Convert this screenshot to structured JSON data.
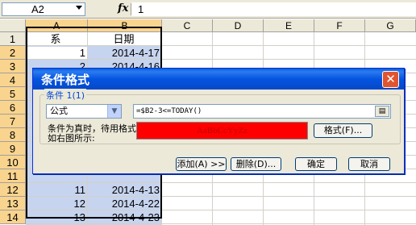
{
  "formula_bar": {
    "name_box": "A2",
    "fx_icon": "fx",
    "formula": "1"
  },
  "columns": [
    "A",
    "B",
    "C",
    "D",
    "E",
    "F",
    "G"
  ],
  "rows": [
    "1",
    "2",
    "3",
    "4",
    "5",
    "6",
    "7",
    "8",
    "9",
    "10",
    "11",
    "12",
    "13",
    "14"
  ],
  "cells": {
    "A1": "系",
    "B1": "日期",
    "A2": "1",
    "B2": "2014-4-17",
    "A3": "2",
    "B3": "2014-4-16",
    "A12": "11",
    "B12": "2014-4-13",
    "A13": "12",
    "B13": "2014-4-22",
    "A14": "13",
    "B14": "2014-4-23"
  },
  "dialog": {
    "title": "条件格式",
    "close_icon": "close-icon",
    "condition_group_label": "条件 1(1)",
    "type_select_value": "公式",
    "formula_value": "=$B2-3<=TODAY()",
    "preview_label": "条件为真时，待用格式如右图所示:",
    "preview_text": "AaBbCcYyZz",
    "format_button": "格式(F)...",
    "add_button": "添加(A) >>",
    "delete_button": "删除(D)...",
    "ok_button": "确定",
    "cancel_button": "取消",
    "preview_color": "#ff0000"
  }
}
